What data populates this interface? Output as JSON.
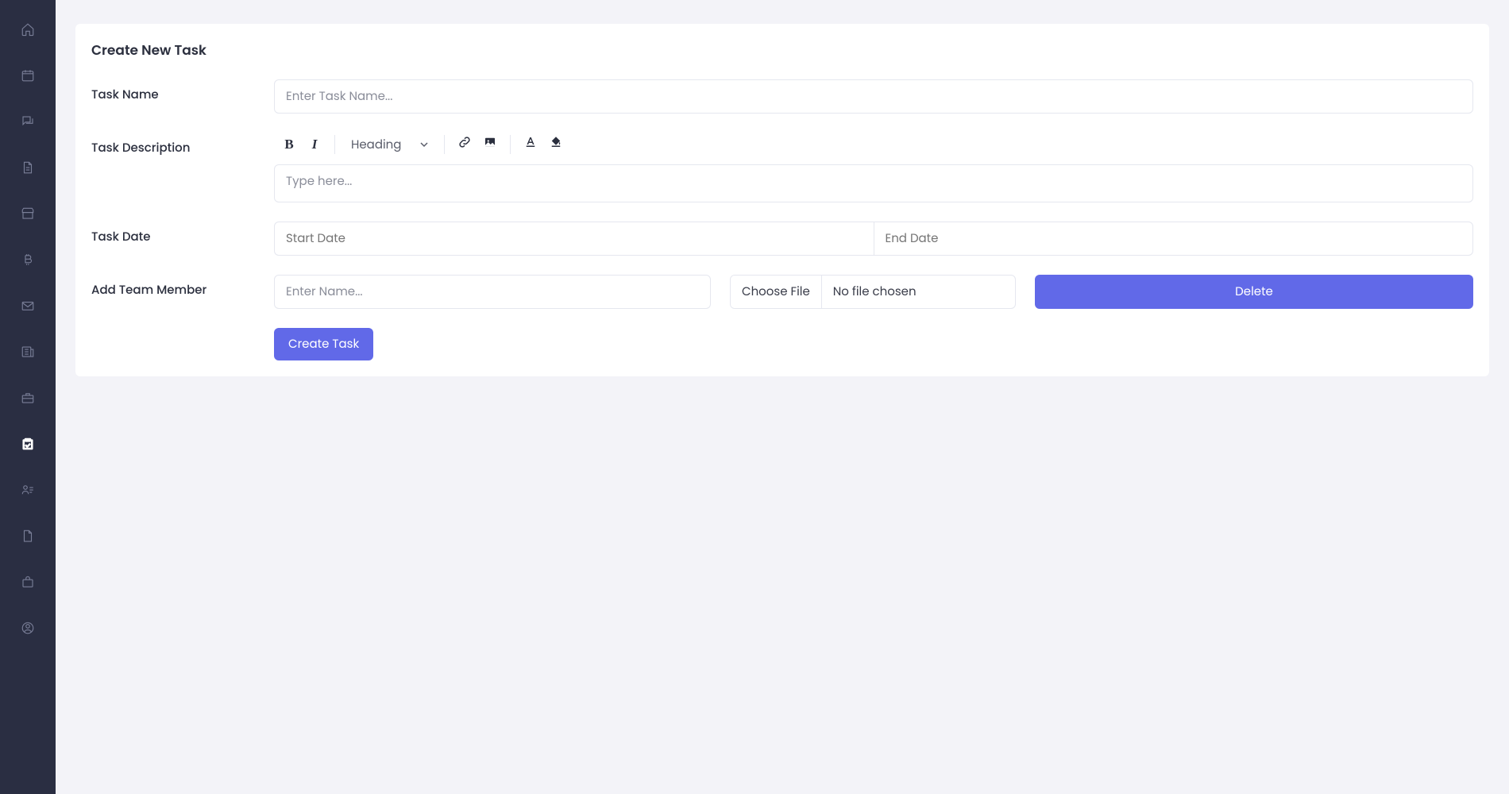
{
  "page": {
    "title": "Create New Task"
  },
  "form": {
    "task_name": {
      "label": "Task Name",
      "placeholder": "Enter Task Name..."
    },
    "task_description": {
      "label": "Task Description",
      "placeholder": "Type here..."
    },
    "task_date": {
      "label": "Task Date",
      "start_placeholder": "Start Date",
      "end_placeholder": "End Date"
    },
    "team_member": {
      "label": "Add Team Member",
      "placeholder": "Enter Name..."
    },
    "file": {
      "button": "Choose File",
      "status": "No file chosen"
    },
    "delete_btn": "Delete",
    "submit_btn": "Create Task"
  },
  "toolbar": {
    "heading_label": "Heading"
  },
  "sidebar": {
    "items": [
      {
        "name": "home"
      },
      {
        "name": "calendar"
      },
      {
        "name": "chat"
      },
      {
        "name": "file"
      },
      {
        "name": "shop"
      },
      {
        "name": "bitcoin"
      },
      {
        "name": "mail"
      },
      {
        "name": "news"
      },
      {
        "name": "briefcase"
      },
      {
        "name": "clipboard",
        "active": true
      },
      {
        "name": "person-list"
      },
      {
        "name": "document"
      },
      {
        "name": "bag"
      },
      {
        "name": "profile"
      }
    ]
  }
}
